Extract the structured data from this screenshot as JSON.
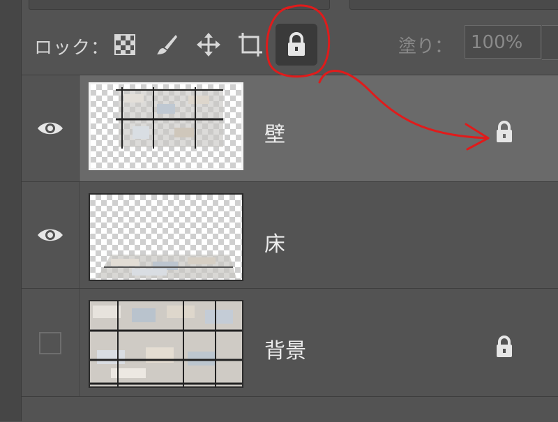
{
  "lock_bar": {
    "label": "ロック：",
    "buttons": [
      {
        "icon": "checker-transparency-lock-icon"
      },
      {
        "icon": "brush-image-lock-icon"
      },
      {
        "icon": "move-position-lock-icon"
      },
      {
        "icon": "artboard-lock-icon"
      },
      {
        "icon": "lock-all-icon",
        "active": true
      }
    ],
    "fill_label": "塗り：",
    "fill_value": "100%"
  },
  "layers": [
    {
      "name": "壁",
      "visible": true,
      "selected": true,
      "locked": true
    },
    {
      "name": "床",
      "visible": true,
      "selected": false,
      "locked": false
    },
    {
      "name": "背景",
      "visible": false,
      "selected": false,
      "locked": true
    }
  ],
  "colors": {
    "panel_bg": "#535353",
    "selected_row": "#6a6a6a",
    "icon": "#d8d8d8",
    "annotation": "#e01b1b"
  }
}
